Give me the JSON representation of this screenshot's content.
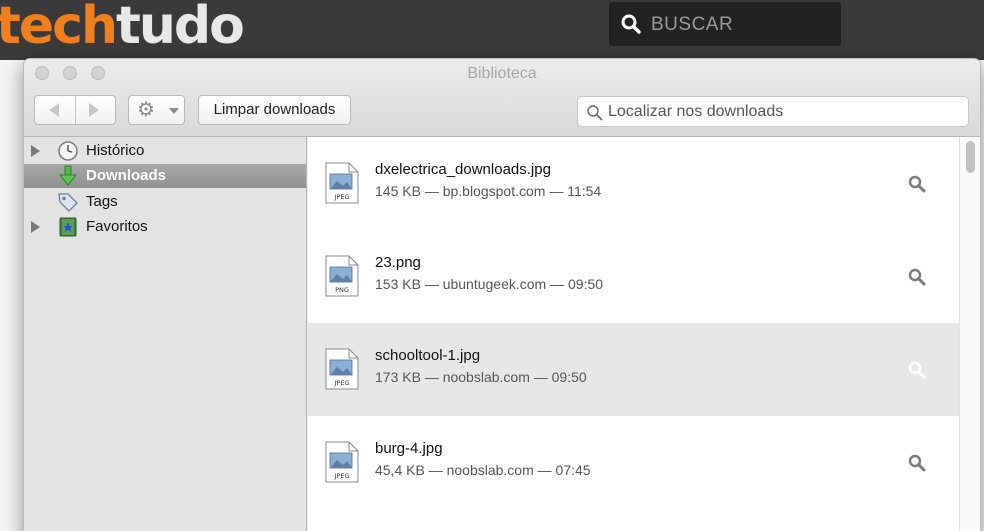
{
  "site": {
    "logo_part1": "tech",
    "logo_part2": "tudo",
    "search_placeholder": "BUSCAR"
  },
  "window": {
    "title": "Biblioteca",
    "toolbar": {
      "clear_label": "Limpar downloads",
      "search_placeholder": "Localizar nos downloads"
    }
  },
  "sidebar": {
    "items": [
      {
        "label": "Histórico",
        "icon": "clock-icon",
        "has_disclosure": true
      },
      {
        "label": "Downloads",
        "icon": "download-arrow-icon",
        "has_disclosure": false,
        "selected": true
      },
      {
        "label": "Tags",
        "icon": "tag-icon",
        "has_disclosure": false
      },
      {
        "label": "Favoritos",
        "icon": "bookmark-icon",
        "has_disclosure": true
      }
    ]
  },
  "downloads": [
    {
      "name": "dxelectrica_downloads.jpg",
      "meta": "145 KB — bp.blogspot.com — 11:54",
      "type": "JPEG"
    },
    {
      "name": "23.png",
      "meta": "153 KB — ubuntugeek.com — 09:50",
      "type": "PNG"
    },
    {
      "name": "schooltool-1.jpg",
      "meta": "173 KB — noobslab.com — 09:50",
      "type": "JPEG",
      "selected": true
    },
    {
      "name": "burg-4.jpg",
      "meta": "45,4 KB — noobslab.com — 07:45",
      "type": "JPEG"
    }
  ],
  "colors": {
    "brand_orange": "#f07f1f",
    "selection_gray": "#9d9d9d"
  }
}
